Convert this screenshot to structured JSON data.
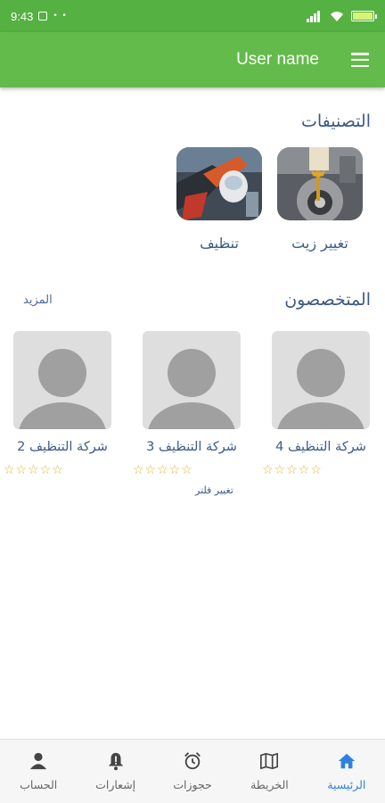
{
  "status_bar": {
    "time": "9:43",
    "dots": "• •"
  },
  "header": {
    "user_name": "User name"
  },
  "categories": {
    "title": "التصنيفات",
    "items": [
      {
        "label": "تغيير زيت",
        "icon": "oil-change-photo"
      },
      {
        "label": "تنظيف",
        "icon": "cleaning-photo"
      }
    ]
  },
  "specialists": {
    "title": "المتخصصون",
    "more_label": "المزيد",
    "items": [
      {
        "name": "شركة التنظيف 4",
        "rating": 0,
        "stars": "☆☆☆☆☆",
        "tag": ""
      },
      {
        "name": "شركة التنظيف 3",
        "rating": 0,
        "stars": "☆☆☆☆☆",
        "tag": "تغيير فلتر"
      },
      {
        "name": "شركة التنظيف 2",
        "rating": 0,
        "stars": "☆☆☆☆☆",
        "tag": ""
      }
    ]
  },
  "bottom_nav": {
    "items": [
      {
        "label": "الرئيسية",
        "icon": "home-icon",
        "active": true
      },
      {
        "label": "الخريطة",
        "icon": "map-icon",
        "active": false
      },
      {
        "label": "حجوزات",
        "icon": "alarm-clock-icon",
        "active": false
      },
      {
        "label": "إشعارات",
        "icon": "bell-icon",
        "active": false
      },
      {
        "label": "الحساب",
        "icon": "person-icon",
        "active": false
      }
    ]
  },
  "colors": {
    "primary_green": "#63bb4b",
    "status_green": "#55b142",
    "title_blue": "#3d5a86",
    "active_blue": "#2f82e0",
    "star": "#e4b42b"
  }
}
